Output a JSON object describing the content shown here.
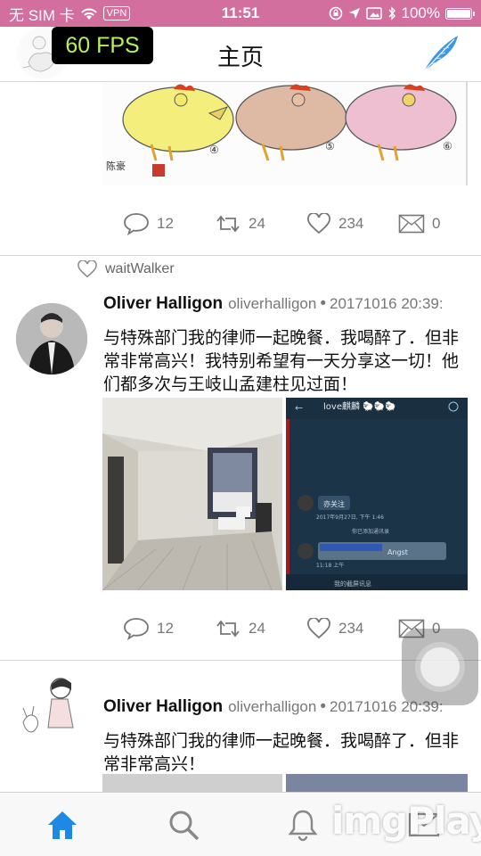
{
  "status_bar": {
    "carrier": "无 SIM 卡",
    "vpn": "VPN",
    "time": "11:51",
    "battery": "100%"
  },
  "nav": {
    "title": "主页",
    "fps": "60 FPS"
  },
  "first_tweet_actions": {
    "comments": "12",
    "retweets": "24",
    "likes": "234",
    "messages": "0"
  },
  "tweet2": {
    "liked_by": "waitWalker",
    "name": "Oliver Halligon",
    "handle": "oliverhalligon",
    "dot": "•",
    "date": "20171016 20:39:",
    "text": "与特殊部门我的律师一起晚餐．我喝醉了．但非常非常高兴！我特别希望有一天分享这一切！他们都多次与王岐山孟建柱见过面！",
    "comments": "12",
    "retweets": "24",
    "likes": "234",
    "messages": "0",
    "chat": {
      "header": "love麒麟 🐑🐑🐑",
      "bubble1": "亦关注",
      "time1": "2017年9月27日, 下午 1:46",
      "notice": "你已添加通讯录",
      "bubble2": "Angst",
      "time2": "11:18 上午",
      "input": "我的截屏讯息"
    }
  },
  "tweet3": {
    "name": "Oliver Halligon",
    "handle": "oliverhalligon",
    "dot": "•",
    "date": "20171016 20:39:",
    "text": "与特殊部门我的律师一起晚餐．我喝醉了．但非常非常高兴！"
  },
  "watermark": "imgPlay",
  "tabs": {
    "home_icon": "home-icon",
    "search_icon": "search-icon",
    "notifications_icon": "bell-icon",
    "messages_icon": "mail-icon",
    "active_color": "#1e88e5"
  }
}
